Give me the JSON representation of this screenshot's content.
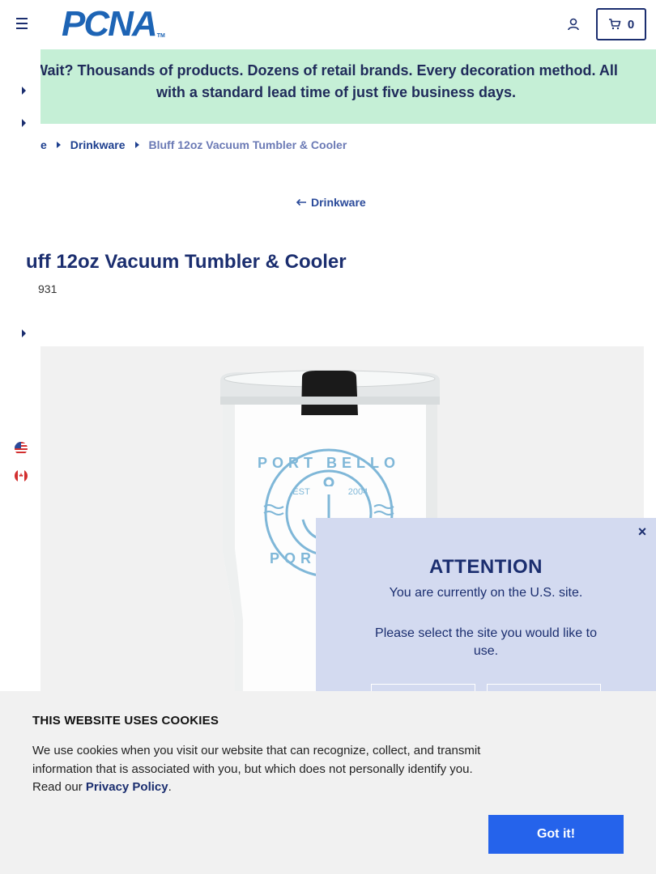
{
  "header": {
    "logo_text": "PCNA",
    "logo_tm": "TM",
    "cart_count": "0"
  },
  "promo": {
    "line1": "y Wait? Thousands of products. Dozens of retail brands. Every decoration method. All",
    "line2": "with a standard lead time of just five business days."
  },
  "breadcrumb": {
    "home_partial": "e",
    "category": "Drinkware",
    "current": "Bluff 12oz Vacuum Tumbler & Cooler"
  },
  "back_link": {
    "label": "Drinkware"
  },
  "product": {
    "title_partial": "uff 12oz Vacuum Tumbler & Cooler",
    "sku_partial": "931",
    "image_print_text": {
      "top": "PORT BELLO",
      "mid_left": "EST",
      "mid_right": "2004",
      "bottom_partial": "PORT"
    }
  },
  "attention": {
    "title": "ATTENTION",
    "message": "You are currently on the U.S. site.",
    "prompt": "Please select the site you would like to use.",
    "close_label": "×"
  },
  "cookie": {
    "title": "THIS WEBSITE USES COOKIES",
    "text": "We use cookies when you visit our website that can recognize, collect, and transmit information that is associated with you, but which does not personally identify you. Read our ",
    "link": "Privacy Policy",
    "period": ".",
    "button": "Got it!"
  },
  "colors": {
    "navy": "#1b2e6f",
    "brand_blue": "#1d64b5",
    "promo_bg": "#c5efd6",
    "attention_bg": "#d3daf0",
    "cookie_button": "#2563eb",
    "product_print": "#7fb7d8"
  }
}
